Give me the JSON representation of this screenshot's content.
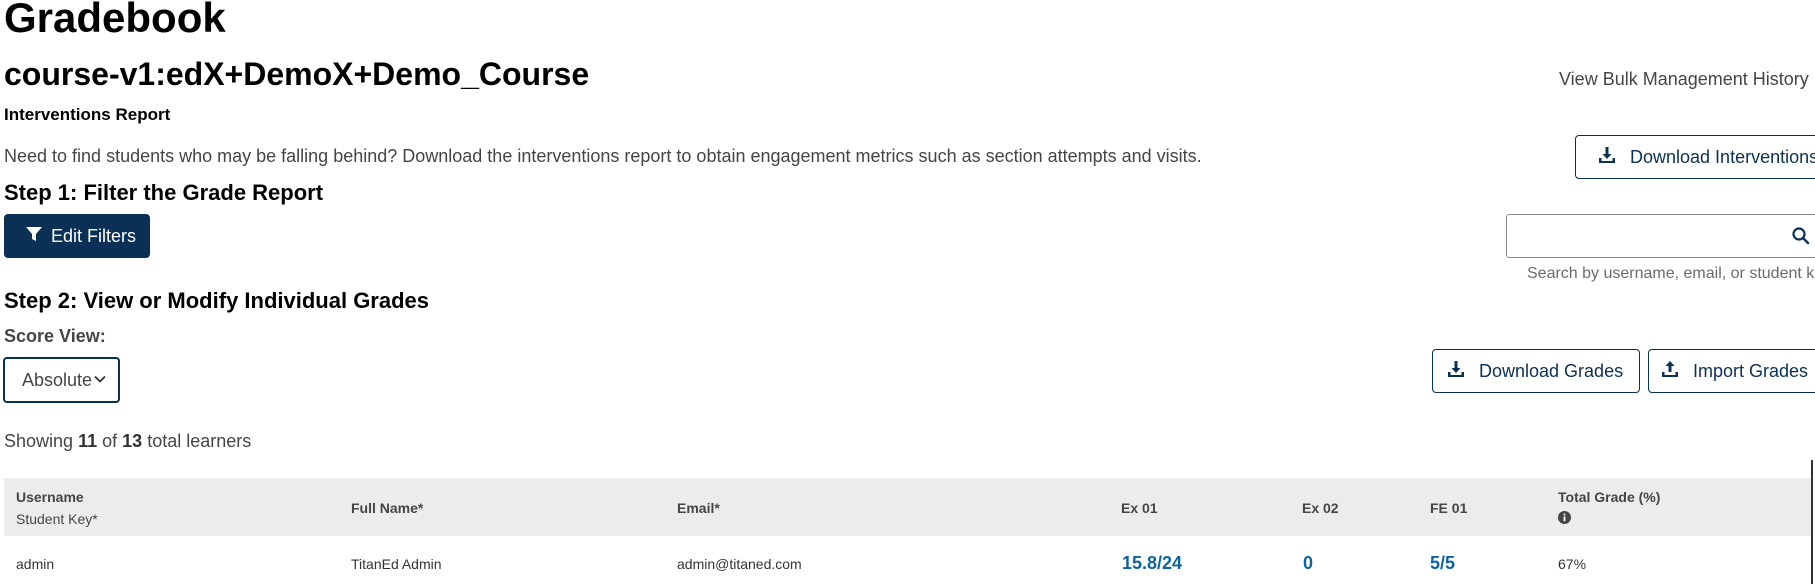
{
  "page": {
    "title": "Gradebook",
    "course_id": "course-v1:edX+DemoX+Demo_Course",
    "bulk_history_link": "View Bulk Management History"
  },
  "interventions": {
    "title": "Interventions Report",
    "description": "Need to find students who may be falling behind? Download the interventions report to obtain engagement metrics such as section attempts and visits.",
    "download_label": "Download Interventions"
  },
  "step1": {
    "title": "Step 1: Filter the Grade Report",
    "edit_filters_label": "Edit Filters",
    "search": {
      "value": "",
      "placeholder": "",
      "help_text": "Search by username, email, or student key"
    }
  },
  "step2": {
    "title": "Step 2: View or Modify Individual Grades",
    "score_view_label": "Score View:",
    "score_view_selected": "Absolute",
    "download_grades_label": "Download Grades",
    "import_grades_label": "Import Grades",
    "showing": {
      "prefix": "Showing",
      "shown": "11",
      "of": "of",
      "total": "13",
      "suffix": "total learners"
    }
  },
  "table": {
    "columns": {
      "username": "Username",
      "student_key": "Student Key*",
      "full_name": "Full Name*",
      "email": "Email*",
      "ex01": "Ex 01",
      "ex02": "Ex 02",
      "fe01": "FE 01",
      "total_grade": "Total Grade (%)"
    },
    "rows": [
      {
        "username": "admin",
        "full_name": "TitanEd Admin",
        "email": "admin@titaned.com",
        "ex01": "15.8/24",
        "ex02": "0",
        "fe01": "5/5",
        "total_grade": "67%"
      }
    ]
  },
  "icons": {
    "download": "download-icon",
    "upload": "upload-icon",
    "filter": "filter-icon",
    "search": "search-icon",
    "chevron": "chevron-down-icon",
    "info": "info-icon"
  },
  "colors": {
    "primary": "#0a3055",
    "link": "#0d63a0",
    "header_bg": "#eeeceb",
    "text": "#454545"
  }
}
